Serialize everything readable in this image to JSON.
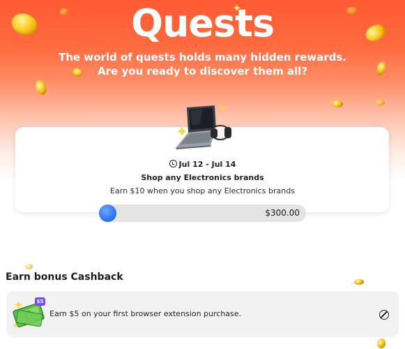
{
  "hero": {
    "title": "Quests",
    "subtitle": "The world of quests holds many hidden rewards. Are you ready to discover them all?"
  },
  "quest": {
    "date_range": "Jul 12 - Jul 14",
    "title": "Shop any Electronics brands",
    "description": "Earn $10 when you shop any Electronics brands",
    "progress_amount": "$300.00",
    "progress_fraction": 0.0,
    "icon": "laptop-icon"
  },
  "bonus": {
    "section_title": "Earn bonus Cashback",
    "badge": "$5",
    "text": "Earn $5 on your first browser extension purchase.",
    "icon": "money-icon",
    "status_icon": "blocked-icon"
  },
  "colors": {
    "hero_orange": "#ff5a32",
    "progress_blue": "#2b6ee8",
    "badge_purple": "#7a4fe0",
    "coin_gold": "#ffd438"
  }
}
